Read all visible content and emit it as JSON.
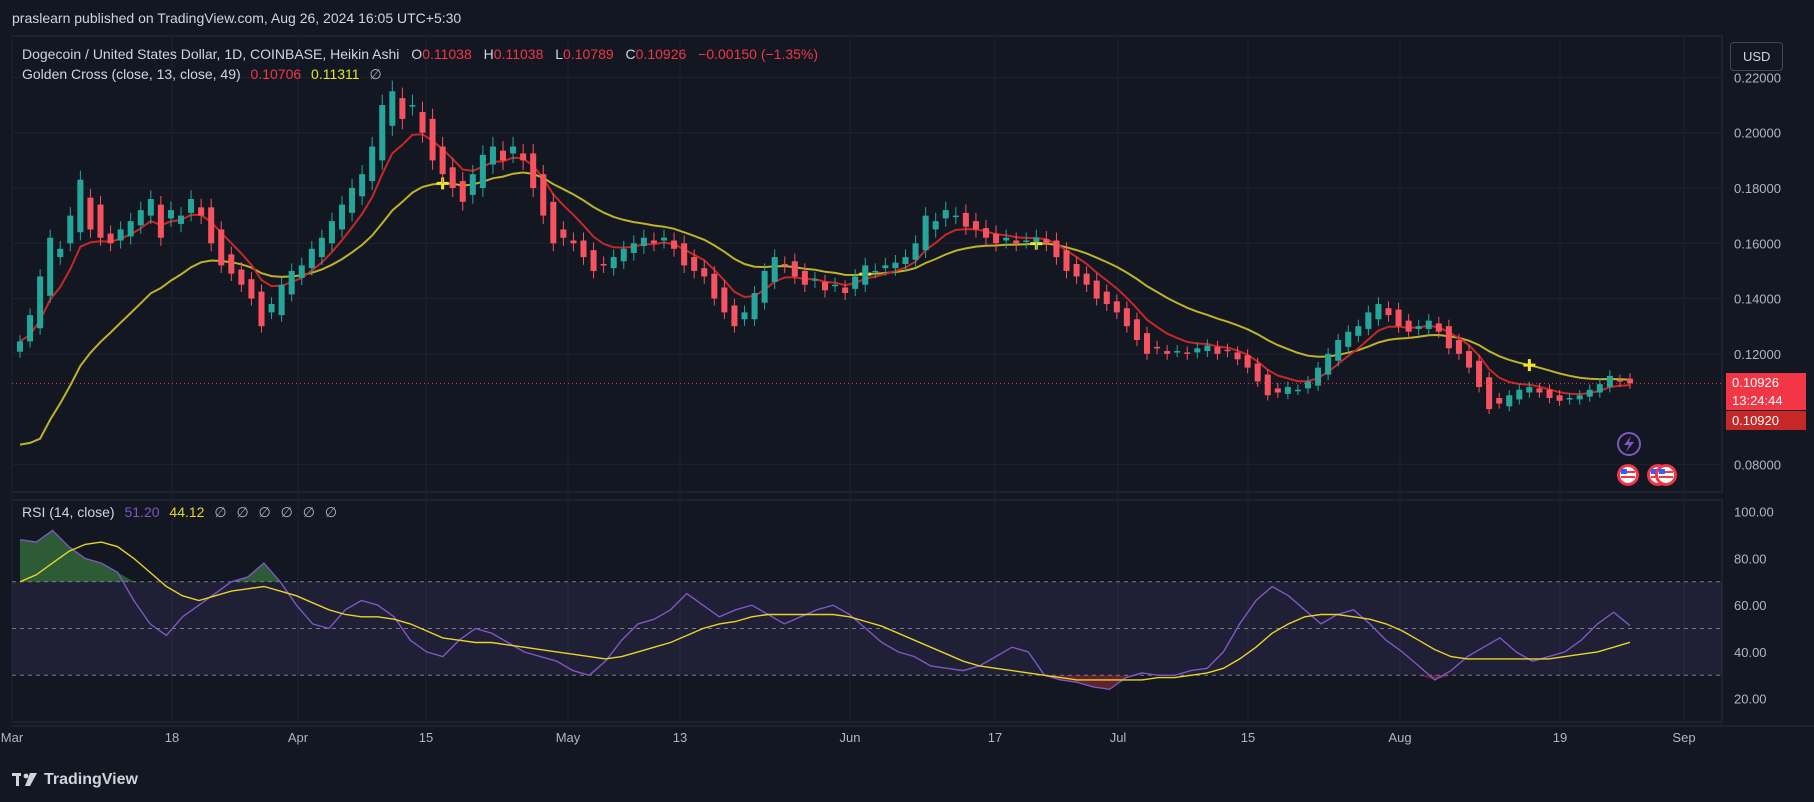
{
  "header": {
    "published_text": "praslearn published on TradingView.com, Aug 26, 2024 16:05 UTC+5:30"
  },
  "legend": {
    "symbol": "Dogecoin / United States Dollar, 1D, COINBASE, Heikin Ashi",
    "ohlc": [
      {
        "label": "O",
        "value": "0.11038"
      },
      {
        "label": "H",
        "value": "0.11038"
      },
      {
        "label": "L",
        "value": "0.10789"
      },
      {
        "label": "C",
        "value": "0.10926"
      }
    ],
    "change": "−0.00150 (−1.35%)",
    "indicator_name": "Golden Cross (close, 13, close, 49)",
    "indicator_values": [
      "0.10706",
      "0.11311"
    ],
    "indicator_null": "∅",
    "rsi_name": "RSI (14, close)",
    "rsi_values": [
      "51.20",
      "44.12"
    ],
    "rsi_nulls": [
      "∅",
      "∅",
      "∅",
      "∅",
      "∅",
      "∅"
    ]
  },
  "toolbar": {
    "currency_label": "USD"
  },
  "price_tags": {
    "last_price": "0.10926",
    "countdown": "13:24:44",
    "ma_value": "0.10920"
  },
  "footer": {
    "brand": "TradingView"
  },
  "colors": {
    "background": "#131722",
    "grid": "#1e222d",
    "up": "#26a69a",
    "down": "#f7525f",
    "fast_ma": "#c62828",
    "slow_ma": "#bdb32a",
    "rsi": "#7e57c2",
    "rsi_ma": "#e8d22c",
    "rsi_band": "#7e57c2"
  },
  "chart_data": [
    {
      "type": "candlestick",
      "title": "Dogecoin / United States Dollar, 1D, COINBASE, Heikin Ashi",
      "ylim": [
        0.07,
        0.235
      ],
      "y_ticks": [
        "0.22000",
        "0.20000",
        "0.18000",
        "0.16000",
        "0.14000",
        "0.12000",
        "0.08000"
      ],
      "x_ticks": [
        "Mar",
        "18",
        "Apr",
        "15",
        "May",
        "13",
        "Jun",
        "17",
        "Jul",
        "15",
        "Aug",
        "19",
        "Sep"
      ],
      "candles_close": [
        0.1245,
        0.134,
        0.148,
        0.162,
        0.158,
        0.17,
        0.183,
        0.165,
        0.162,
        0.16,
        0.165,
        0.168,
        0.172,
        0.176,
        0.162,
        0.172,
        0.17,
        0.176,
        0.17,
        0.16,
        0.152,
        0.149,
        0.145,
        0.14,
        0.13,
        0.138,
        0.145,
        0.15,
        0.152,
        0.158,
        0.162,
        0.168,
        0.174,
        0.18,
        0.185,
        0.195,
        0.21,
        0.215,
        0.205,
        0.21,
        0.2,
        0.19,
        0.185,
        0.18,
        0.175,
        0.185,
        0.192,
        0.195,
        0.19,
        0.195,
        0.19,
        0.18,
        0.17,
        0.16,
        0.162,
        0.16,
        0.155,
        0.15,
        0.152,
        0.155,
        0.158,
        0.16,
        0.162,
        0.16,
        0.162,
        0.158,
        0.152,
        0.15,
        0.148,
        0.14,
        0.135,
        0.13,
        0.135,
        0.142,
        0.15,
        0.155,
        0.152,
        0.148,
        0.145,
        0.147,
        0.143,
        0.145,
        0.142,
        0.148,
        0.152,
        0.15,
        0.152,
        0.153,
        0.155,
        0.16,
        0.17,
        0.168,
        0.172,
        0.17,
        0.166,
        0.165,
        0.162,
        0.16,
        0.162,
        0.16,
        0.161,
        0.162,
        0.16,
        0.155,
        0.15,
        0.148,
        0.145,
        0.14,
        0.138,
        0.135,
        0.13,
        0.125,
        0.12,
        0.122,
        0.12,
        0.121,
        0.12,
        0.122,
        0.123,
        0.12,
        0.121,
        0.118,
        0.115,
        0.11,
        0.105,
        0.106,
        0.108,
        0.107,
        0.11,
        0.115,
        0.12,
        0.125,
        0.128,
        0.13,
        0.135,
        0.138,
        0.134,
        0.13,
        0.128,
        0.13,
        0.132,
        0.128,
        0.122,
        0.12,
        0.115,
        0.108,
        0.1,
        0.102,
        0.105,
        0.107,
        0.108,
        0.106,
        0.104,
        0.103,
        0.104,
        0.105,
        0.107,
        0.109,
        0.112,
        0.11,
        0.1093
      ]
    },
    {
      "type": "line",
      "title": "RSI (14, close)",
      "ylim": [
        10,
        105
      ],
      "y_ticks": [
        "100.00",
        "80.00",
        "60.00",
        "40.00",
        "20.00"
      ],
      "bands": [
        30,
        50,
        70
      ],
      "series": [
        {
          "name": "RSI",
          "values": [
            88,
            87,
            92,
            85,
            80,
            78,
            74,
            62,
            52,
            47,
            55,
            60,
            65,
            70,
            72,
            78,
            70,
            60,
            52,
            50,
            58,
            62,
            60,
            55,
            45,
            40,
            38,
            45,
            50,
            48,
            44,
            40,
            38,
            36,
            32,
            30,
            36,
            45,
            52,
            54,
            58,
            65,
            60,
            55,
            58,
            60,
            56,
            52,
            55,
            58,
            60,
            56,
            50,
            44,
            40,
            38,
            34,
            33,
            32,
            34,
            38,
            42,
            40,
            30,
            28,
            27,
            25,
            24,
            29,
            31,
            30,
            30,
            32,
            33,
            40,
            52,
            62,
            68,
            64,
            58,
            52,
            56,
            58,
            52,
            45,
            40,
            34,
            28,
            32,
            38,
            42,
            46,
            40,
            36,
            38,
            40,
            45,
            52,
            57,
            51.2
          ]
        },
        {
          "name": "RSI MA",
          "values": [
            70,
            73,
            78,
            83,
            86,
            87,
            85,
            80,
            74,
            68,
            64,
            62,
            64,
            66,
            67,
            68,
            66,
            64,
            61,
            58,
            56,
            55,
            55,
            54,
            52,
            49,
            46,
            45,
            44,
            44,
            43,
            42,
            41,
            40,
            39,
            38,
            37,
            38,
            40,
            42,
            44,
            47,
            50,
            52,
            53,
            55,
            56,
            56,
            56,
            56,
            56,
            55,
            53,
            51,
            48,
            45,
            42,
            39,
            36,
            34,
            33,
            32,
            31,
            30,
            29,
            28,
            28,
            28,
            28,
            28,
            29,
            29,
            30,
            31,
            33,
            37,
            42,
            48,
            52,
            55,
            56,
            56,
            55,
            54,
            52,
            49,
            45,
            41,
            38,
            37,
            37,
            37,
            37,
            37,
            37,
            38,
            39,
            40,
            42,
            44.12
          ]
        }
      ]
    }
  ]
}
